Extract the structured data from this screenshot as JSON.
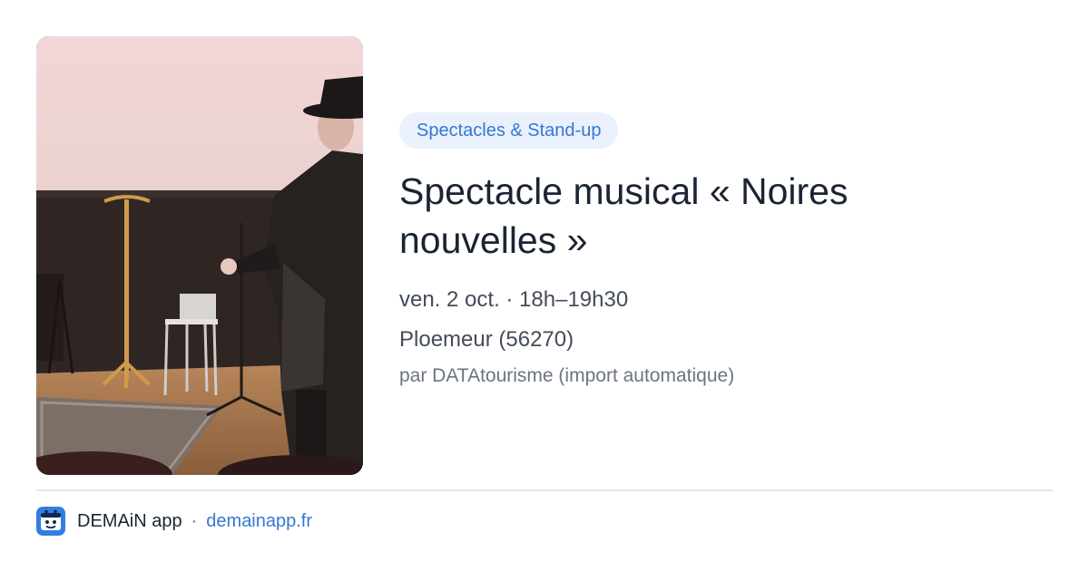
{
  "card": {
    "image_alt": "Performer in a dark hat and coat singing on a small stage",
    "category_badge": "Spectacles & Stand-up",
    "title": "Spectacle musical « Noires nouvelles »",
    "datetime": "ven. 2 oct. · 18h–19h30",
    "location": "Ploemeur (56270)",
    "source": "par DATAtourisme (import automatique)"
  },
  "footer": {
    "app_name": "DEMAiN app",
    "separator": "·",
    "site_link": "demainapp.fr"
  },
  "colors": {
    "accent": "#3478d3",
    "badge_bg": "#eaf1fc",
    "title": "#1b2433",
    "muted": "#444c58",
    "divider": "#e3e8ed"
  },
  "icons": {
    "app_icon": "demain-app-logo-icon"
  }
}
